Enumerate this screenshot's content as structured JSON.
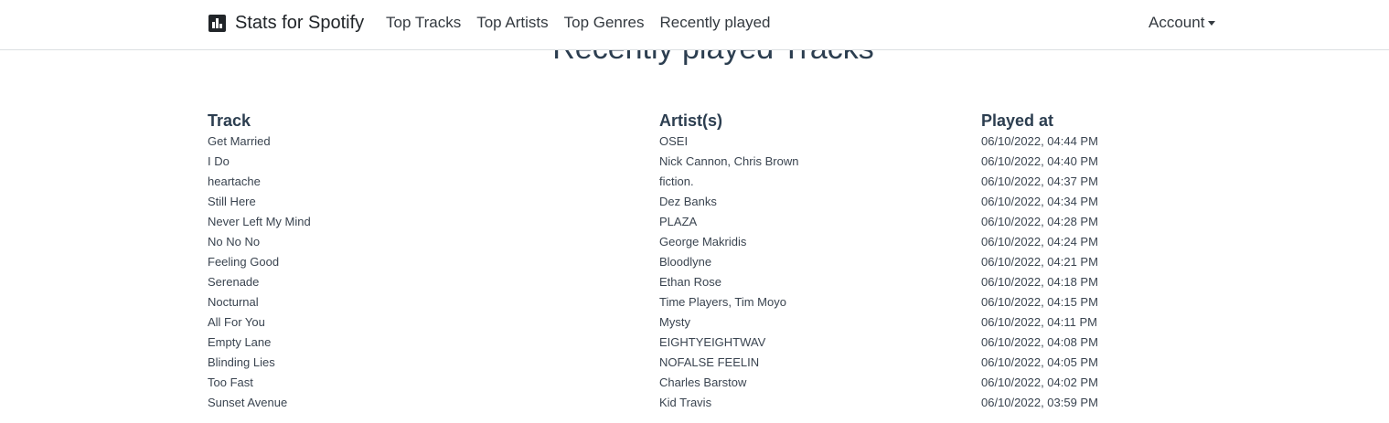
{
  "navbar": {
    "brand": "Stats for Spotify",
    "brand_icon": "bar-chart-icon",
    "links": [
      "Top Tracks",
      "Top Artists",
      "Top Genres",
      "Recently played"
    ],
    "account": "Account"
  },
  "page": {
    "title": "Recently played Tracks"
  },
  "table": {
    "headers": [
      "Track",
      "Artist(s)",
      "Played at"
    ],
    "rows": [
      [
        "Get Married",
        "OSEI",
        "06/10/2022, 04:44 PM"
      ],
      [
        "I Do",
        "Nick Cannon, Chris Brown",
        "06/10/2022, 04:40 PM"
      ],
      [
        "heartache",
        "fiction.",
        "06/10/2022, 04:37 PM"
      ],
      [
        "Still Here",
        "Dez Banks",
        "06/10/2022, 04:34 PM"
      ],
      [
        "Never Left My Mind",
        "PLAZA",
        "06/10/2022, 04:28 PM"
      ],
      [
        "No No No",
        "George Makridis",
        "06/10/2022, 04:24 PM"
      ],
      [
        "Feeling Good",
        "Bloodlyne",
        "06/10/2022, 04:21 PM"
      ],
      [
        "Serenade",
        "Ethan Rose",
        "06/10/2022, 04:18 PM"
      ],
      [
        "Nocturnal",
        "Time Players, Tim Moyo",
        "06/10/2022, 04:15 PM"
      ],
      [
        "All For You",
        "Mysty",
        "06/10/2022, 04:11 PM"
      ],
      [
        "Empty Lane",
        "EIGHTYEIGHTWAV",
        "06/10/2022, 04:08 PM"
      ],
      [
        "Blinding Lies",
        "NOFALSE FEELIN",
        "06/10/2022, 04:05 PM"
      ],
      [
        "Too Fast",
        "Charles Barstow",
        "06/10/2022, 04:02 PM"
      ],
      [
        "Sunset Avenue",
        "Kid Travis",
        "06/10/2022, 03:59 PM"
      ]
    ]
  }
}
